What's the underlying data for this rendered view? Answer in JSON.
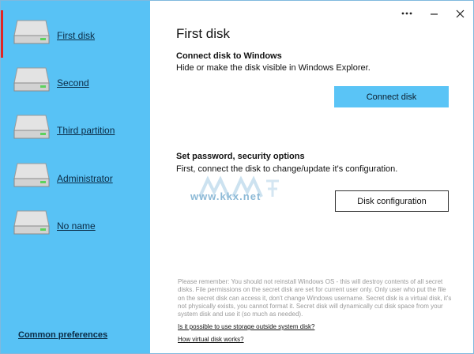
{
  "sidebar": {
    "disks": [
      {
        "label": "First disk",
        "active": true
      },
      {
        "label": "Second",
        "active": false
      },
      {
        "label": "Third partition",
        "active": false
      },
      {
        "label": "Administrator",
        "active": false
      },
      {
        "label": "No name",
        "active": false
      }
    ],
    "common_preferences": "Common preferences"
  },
  "titlebar": {
    "more_icon": "more-horizontal-icon",
    "minimize_icon": "minimize-icon",
    "close_icon": "close-icon"
  },
  "main": {
    "title": "First disk",
    "connect": {
      "heading": "Connect disk to Windows",
      "description": "Hide or make the disk visible in Windows Explorer.",
      "button": "Connect disk"
    },
    "security": {
      "heading": "Set password, security options",
      "description": "First, connect the disk to change/update it's configuration.",
      "button": "Disk configuration"
    },
    "watermark": "www.kkx.net",
    "notice": "Please remember: You should not reinstall Windows OS - this will destroy contents of all secret disks. File permissions on the secret disk are set for current user only. Only user who put the file on the secret disk can access it, don't change Windows username. Secret disk is a virtual disk, it's not physically exists, you cannot format it. Secret disk will dynamically cut disk space from your system disk and use it (so much as needed).",
    "links": [
      "Is it possible to use storage outside system disk?",
      "How virtual disk works?"
    ]
  },
  "colors": {
    "sidebar_bg": "#58c2f5",
    "accent_button": "#5ac4f6",
    "active_indicator": "#e02525"
  }
}
